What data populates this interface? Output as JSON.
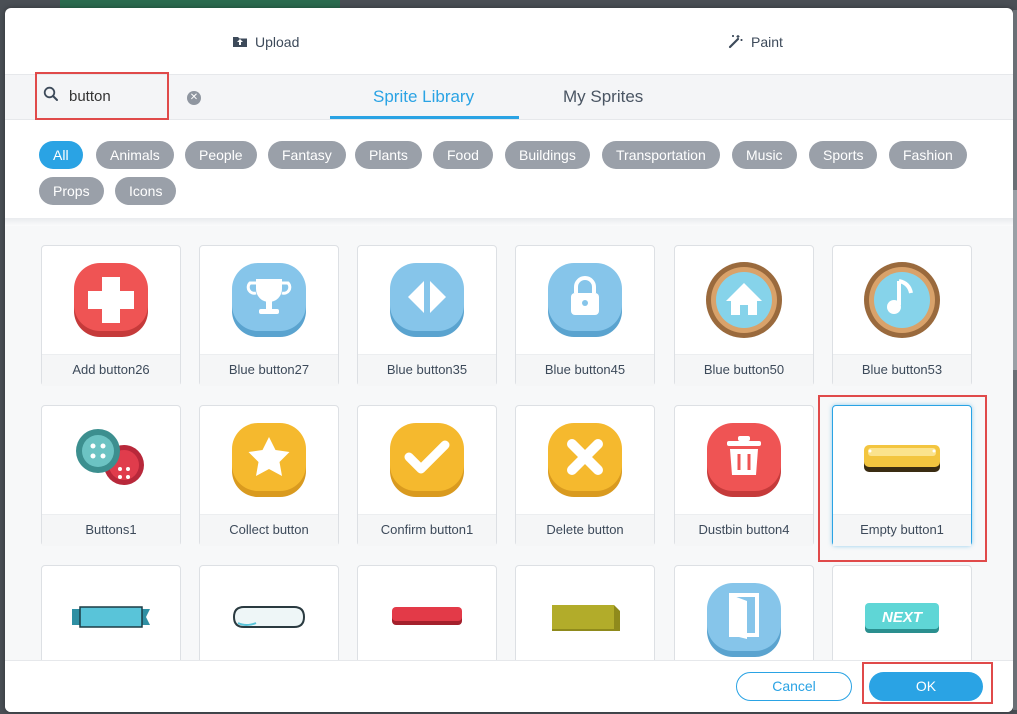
{
  "top_actions": {
    "upload": "Upload",
    "paint": "Paint"
  },
  "search": {
    "value": "button",
    "placeholder": ""
  },
  "tabs": [
    {
      "label": "Sprite Library",
      "active": true
    },
    {
      "label": "My Sprites",
      "active": false
    }
  ],
  "categories": [
    "All",
    "Animals",
    "People",
    "Fantasy",
    "Plants",
    "Food",
    "Buildings",
    "Transportation",
    "Music",
    "Sports",
    "Fashion",
    "Props",
    "Icons"
  ],
  "active_category": "All",
  "sprites": [
    {
      "label": "Add button26",
      "icon": "plus-icon"
    },
    {
      "label": "Blue button27",
      "icon": "trophy-icon"
    },
    {
      "label": "Blue button35",
      "icon": "play-pause-icon"
    },
    {
      "label": "Blue button45",
      "icon": "lock-icon"
    },
    {
      "label": "Blue button50",
      "icon": "home-icon"
    },
    {
      "label": "Blue button53",
      "icon": "music-note-icon"
    },
    {
      "label": "Buttons1",
      "icon": "sewing-buttons-icon"
    },
    {
      "label": "Collect button",
      "icon": "star-icon"
    },
    {
      "label": "Confirm button1",
      "icon": "checkmark-icon"
    },
    {
      "label": "Delete button",
      "icon": "x-icon"
    },
    {
      "label": "Dustbin button4",
      "icon": "trash-icon"
    },
    {
      "label": "Empty button1",
      "icon": "empty-button-icon",
      "selected": true
    },
    {
      "label": "",
      "icon": "ribbon-banner-icon"
    },
    {
      "label": "",
      "icon": "scroll-banner-icon"
    },
    {
      "label": "",
      "icon": "red-bar-icon"
    },
    {
      "label": "",
      "icon": "olive-bar-icon"
    },
    {
      "label": "",
      "icon": "door-icon"
    },
    {
      "label": "NEXT",
      "icon": "next-button-icon"
    }
  ],
  "footer": {
    "cancel": "Cancel",
    "ok": "OK"
  },
  "colors": {
    "accent": "#2aa3e4",
    "chip": "#9aa0a9",
    "highlight": "#e04a4a"
  }
}
